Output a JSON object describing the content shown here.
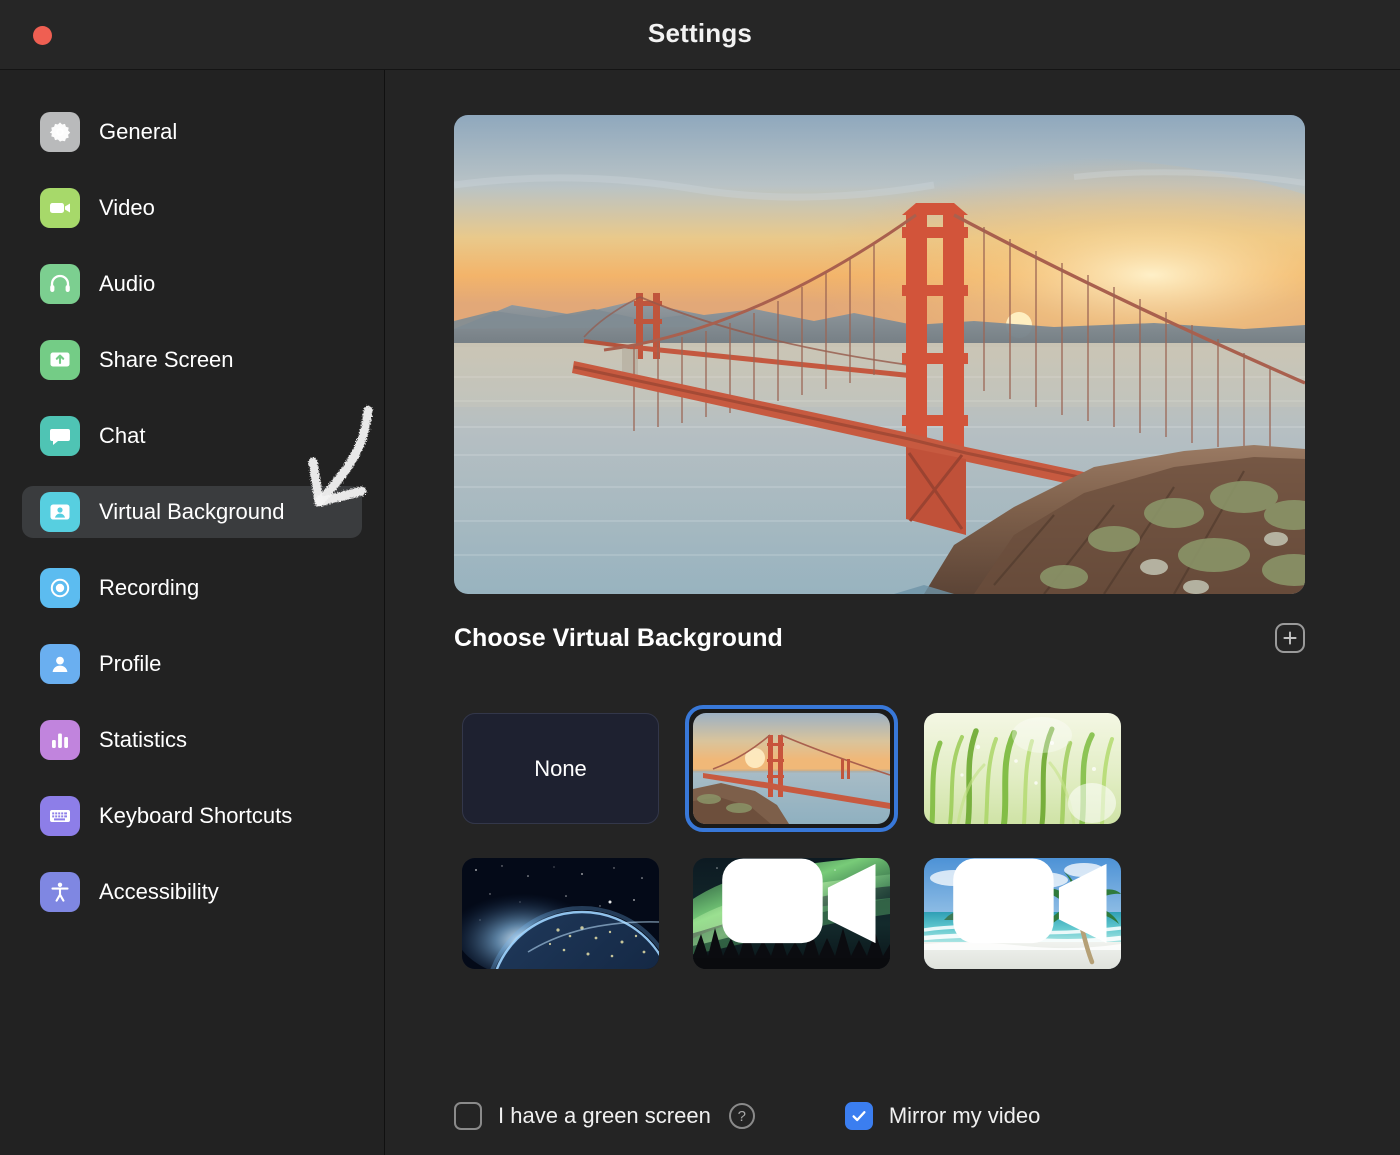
{
  "window": {
    "title": "Settings",
    "close_button": "close",
    "accent_color": "#3878d9",
    "selected_nav_bg": "#3a3c3e"
  },
  "sidebar": {
    "items": [
      {
        "label": "General",
        "icon": "gear-icon",
        "icon_color": "#b9babb",
        "selected": false
      },
      {
        "label": "Video",
        "icon": "video-camera-icon",
        "icon_color": "#a7d96a",
        "selected": false
      },
      {
        "label": "Audio",
        "icon": "headphones-icon",
        "icon_color": "#7ccf90",
        "selected": false
      },
      {
        "label": "Share Screen",
        "icon": "share-screen-icon",
        "icon_color": "#74cc86",
        "selected": false
      },
      {
        "label": "Chat",
        "icon": "chat-bubble-icon",
        "icon_color": "#4fc4b4",
        "selected": false
      },
      {
        "label": "Virtual Background",
        "icon": "virtual-background-icon",
        "icon_color": "#57cfe0",
        "selected": true
      },
      {
        "label": "Recording",
        "icon": "record-icon",
        "icon_color": "#5cbcf0",
        "selected": false
      },
      {
        "label": "Profile",
        "icon": "person-icon",
        "icon_color": "#6aaff0",
        "selected": false
      },
      {
        "label": "Statistics",
        "icon": "bar-chart-icon",
        "icon_color": "#c184dd",
        "selected": false
      },
      {
        "label": "Keyboard Shortcuts",
        "icon": "keyboard-icon",
        "icon_color": "#8d7ee8",
        "selected": false
      },
      {
        "label": "Accessibility",
        "icon": "accessibility-icon",
        "icon_color": "#7f87e2",
        "selected": false
      }
    ]
  },
  "annotation": {
    "arrow": "down-left-chalk-arrow",
    "points_to": "Virtual Background"
  },
  "main": {
    "preview_alt": "Golden Gate Bridge at sunset",
    "section_title": "Choose Virtual Background",
    "add_button_label": "+",
    "backgrounds": [
      {
        "label": "None",
        "kind": "none",
        "selected": false,
        "has_video_badge": false
      },
      {
        "label": "Golden Gate Bridge",
        "kind": "bridge",
        "selected": true,
        "has_video_badge": false
      },
      {
        "label": "Grass",
        "kind": "grass",
        "selected": false,
        "has_video_badge": false
      },
      {
        "label": "Earth from Space",
        "kind": "space",
        "selected": false,
        "has_video_badge": false
      },
      {
        "label": "Aurora Borealis",
        "kind": "aurora",
        "selected": false,
        "has_video_badge": true
      },
      {
        "label": "Tropical Beach",
        "kind": "beach",
        "selected": false,
        "has_video_badge": true
      }
    ]
  },
  "footer": {
    "green_screen": {
      "label": "I have a green screen",
      "checked": false,
      "help": "?"
    },
    "mirror_video": {
      "label": "Mirror my video",
      "checked": true
    }
  }
}
